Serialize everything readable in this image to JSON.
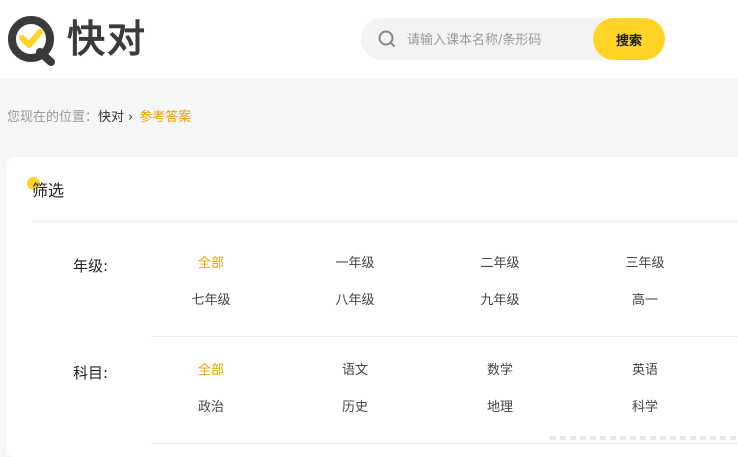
{
  "brand": {
    "name": "快对",
    "accent": "#ffd426",
    "logo_color": "#3a3a3a"
  },
  "search": {
    "placeholder": "请输入课本名称/条形码",
    "button_label": "搜索"
  },
  "breadcrumb": {
    "prefix": "您现在的位置：",
    "home": "快对",
    "separator": "›",
    "current": "参考答案"
  },
  "filter": {
    "title": "筛选",
    "grade": {
      "label": "年级:",
      "options": [
        "全部",
        "一年级",
        "二年级",
        "三年级",
        "七年级",
        "八年级",
        "九年级",
        "高一"
      ],
      "active": "全部"
    },
    "subject": {
      "label": "科目:",
      "options": [
        "全部",
        "语文",
        "数学",
        "英语",
        "政治",
        "历史",
        "地理",
        "科学"
      ],
      "active": "全部"
    }
  },
  "colors": {
    "active_option": "#f0a000",
    "page_bg": "#f5f6f8"
  }
}
